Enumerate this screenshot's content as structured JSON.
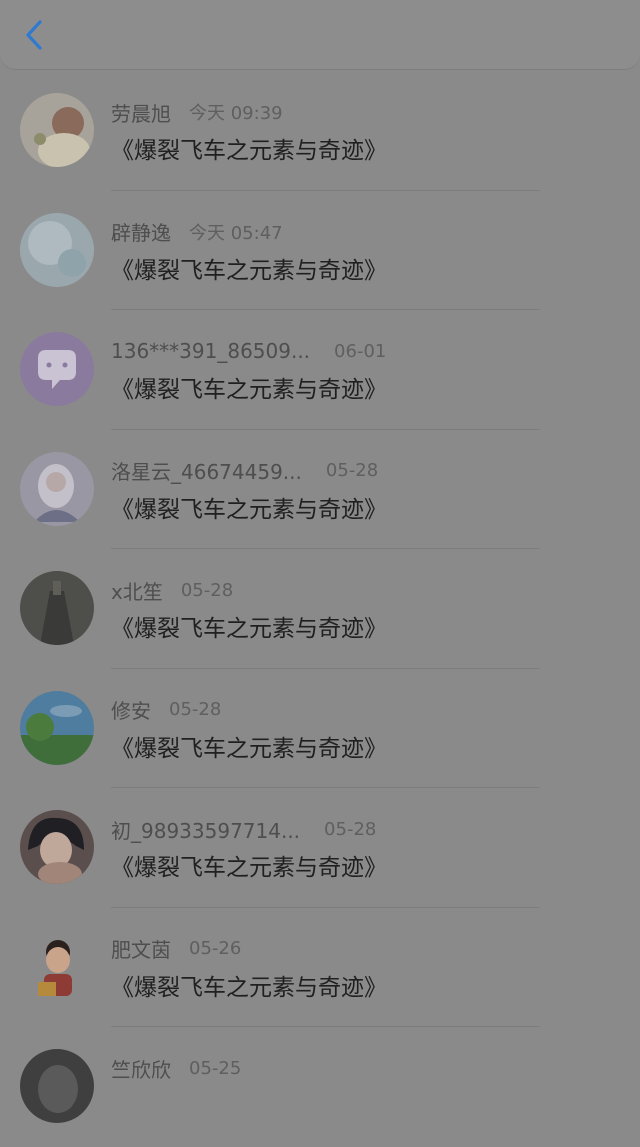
{
  "header": {
    "back_icon": "chevron-left-icon",
    "accent": "#2f7ad0"
  },
  "comments": [
    {
      "name": "劳晨旭",
      "time": "今天 09:39",
      "text": "《爆裂飞车之元素与奇迹》"
    },
    {
      "name": "辟静逸",
      "time": "今天 05:47",
      "text": "《爆裂飞车之元素与奇迹》"
    },
    {
      "name": "136***391_86509...",
      "time": "06-01",
      "text": "《爆裂飞车之元素与奇迹》"
    },
    {
      "name": "洛星云_46674459...",
      "time": "05-28",
      "text": "《爆裂飞车之元素与奇迹》"
    },
    {
      "name": "x北笙",
      "time": "05-28",
      "text": "《爆裂飞车之元素与奇迹》"
    },
    {
      "name": "修安",
      "time": "05-28",
      "text": "《爆裂飞车之元素与奇迹》"
    },
    {
      "name": "初_98933597714...",
      "time": "05-28",
      "text": "《爆裂飞车之元素与奇迹》"
    },
    {
      "name": "肥文茵",
      "time": "05-26",
      "text": "《爆裂飞车之元素与奇迹》"
    },
    {
      "name": "竺欣欣",
      "time": "05-25",
      "text": ""
    }
  ]
}
